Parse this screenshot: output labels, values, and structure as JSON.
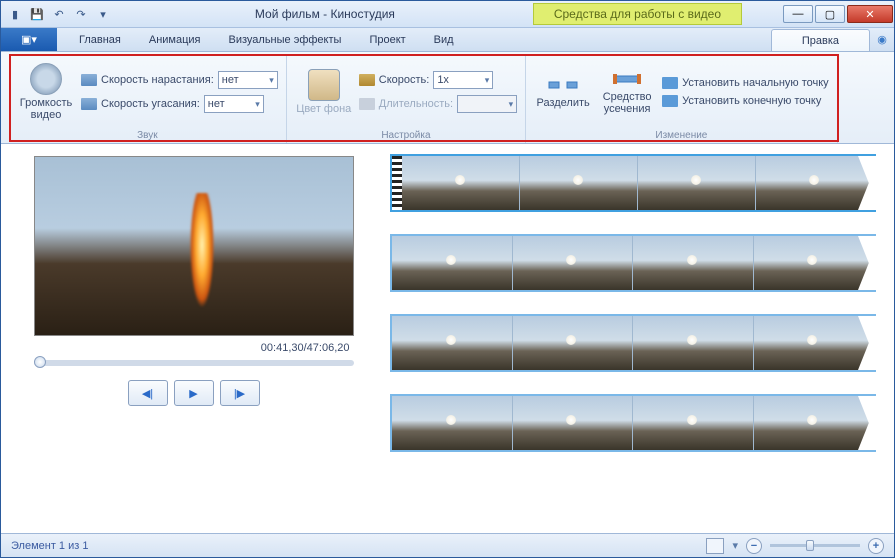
{
  "title": "Мой фильм - Киностудия",
  "tool_tab_header": "Средства для работы с видео",
  "tabs": {
    "main": "Главная",
    "animation": "Анимация",
    "effects": "Визуальные эффекты",
    "project": "Проект",
    "view": "Вид",
    "edit": "Правка"
  },
  "ribbon": {
    "volume_label": "Громкость видео",
    "fade_in_label": "Скорость нарастания:",
    "fade_in_value": "нет",
    "fade_out_label": "Скорость угасания:",
    "fade_out_value": "нет",
    "sound_group": "Звук",
    "bgcolor_label": "Цвет фона",
    "speed_label": "Скорость:",
    "speed_value": "1x",
    "duration_label": "Длительность:",
    "duration_value": "",
    "adjust_group": "Настройка",
    "split_label": "Разделить",
    "trim_label": "Средство усечения",
    "set_start_label": "Установить начальную точку",
    "set_end_label": "Установить конечную точку",
    "edit_group": "Изменение"
  },
  "preview": {
    "time": "00:41,30/47:06,20"
  },
  "status": {
    "item_count": "Элемент 1 из 1"
  }
}
